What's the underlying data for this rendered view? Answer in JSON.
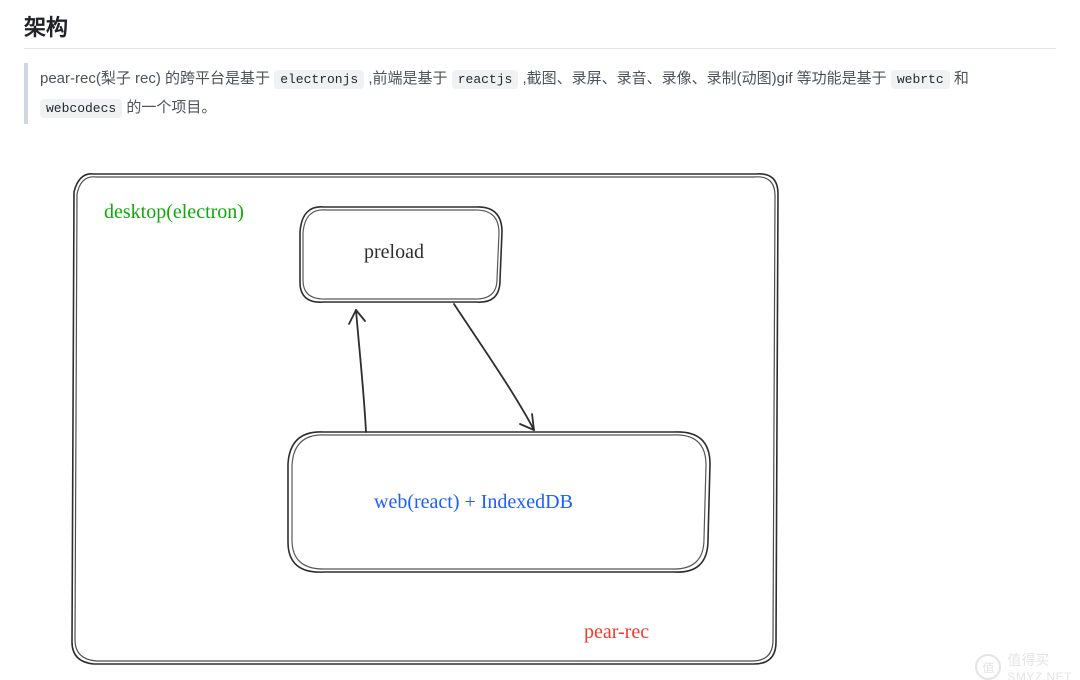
{
  "heading": "架构",
  "intro": {
    "part1": "pear-rec(梨子 rec) 的跨平台是基于 ",
    "code1": "electronjs",
    "part2": " ,前端是基于 ",
    "code2": "reactjs",
    "part3": " ,截图、录屏、录音、录像、录制(动图)gif 等功能是基于 ",
    "code3": "webrtc",
    "part4": " 和 ",
    "code4": "webcodecs",
    "part5": " 的一个项目。"
  },
  "diagram": {
    "outer_label": "desktop(electron)",
    "top_box": "preload",
    "bottom_box": "web(react) + IndexedDB",
    "footer_label": "pear-rec"
  },
  "watermark": {
    "badge": "值",
    "text": "值得买",
    "site": "SMYZ.NET"
  }
}
